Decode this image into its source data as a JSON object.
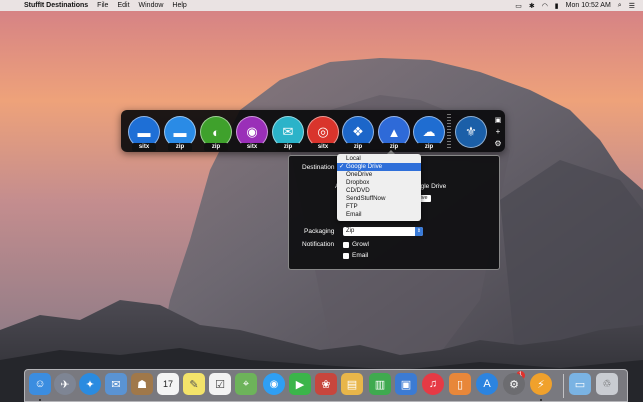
{
  "menubar": {
    "apple_icon": "",
    "app_name": "StuffIt Destinations",
    "menus": [
      "File",
      "Edit",
      "Window",
      "Help"
    ],
    "clock": "Mon 10:52 AM",
    "status_icons": [
      "bluetooth-icon",
      "wifi-icon",
      "battery-icon"
    ],
    "spotlight_icon": "⌕",
    "list_icon": "☰"
  },
  "destinations": [
    {
      "icon": "folder-icon",
      "glyph": "▬",
      "badge": "sitx",
      "color": "#1e6fd6"
    },
    {
      "icon": "folder-icon",
      "glyph": "▬",
      "badge": "zip",
      "color": "#2a8be6"
    },
    {
      "icon": "half-circle-icon",
      "glyph": "◐",
      "badge": "zip",
      "color": "#3fa12c"
    },
    {
      "icon": "disc-icon",
      "glyph": "◉",
      "badge": "sitx",
      "color": "#9a2fb8"
    },
    {
      "icon": "mail-icon",
      "glyph": "✉",
      "badge": "zip",
      "color": "#2bb3c9"
    },
    {
      "icon": "cd-icon",
      "glyph": "◎",
      "badge": "sitx",
      "color": "#d9342c"
    },
    {
      "icon": "dropbox-icon",
      "glyph": "❖",
      "badge": "zip",
      "color": "#1c66c9"
    },
    {
      "icon": "google-drive-icon",
      "glyph": "▲",
      "badge": "zip",
      "color": "#2e6ad8"
    },
    {
      "icon": "cloud-icon",
      "glyph": "☁",
      "badge": "zip",
      "color": "#1f6dd1"
    },
    {
      "icon": "sendstuffnow-icon",
      "glyph": "⚜",
      "badge": "",
      "color": "#1b5fa8"
    }
  ],
  "bar_controls": [
    "lock-icon",
    "plus-icon",
    "gear-icon"
  ],
  "bar_control_glyphs": [
    "🔒",
    "+",
    "⚙"
  ],
  "panel": {
    "destination_label": "Destination",
    "behind_text": "ogle Drive",
    "behind_field": "ive",
    "behind_letter": "A",
    "packaging_label": "Packaging",
    "packaging_value": "Zip",
    "notification_label": "Notification",
    "growl_label": "Growl",
    "email_label": "Email"
  },
  "dropdown": {
    "options": [
      "Local",
      "Google Drive",
      "OneDrive",
      "Dropbox",
      "CD/DVD",
      "SendStuffNow",
      "FTP",
      "Email"
    ],
    "selected": "Google Drive",
    "check": "✓"
  },
  "dock": {
    "apps": [
      {
        "name": "finder-icon",
        "glyph": "☺",
        "color": "#3b8de0"
      },
      {
        "name": "launchpad-icon",
        "glyph": "✈",
        "color": "#7e8594"
      },
      {
        "name": "safari-icon",
        "glyph": "✦",
        "color": "#2a8be0"
      },
      {
        "name": "mail-app-icon",
        "glyph": "✉",
        "color": "#5a93d3"
      },
      {
        "name": "contacts-icon",
        "glyph": "☗",
        "color": "#a0784a"
      },
      {
        "name": "calendar-icon",
        "glyph": "17",
        "color": "#f4f4f4"
      },
      {
        "name": "notes-icon",
        "glyph": "✎",
        "color": "#f3e36a"
      },
      {
        "name": "reminders-icon",
        "glyph": "☑",
        "color": "#f2f2f2"
      },
      {
        "name": "maps-icon",
        "glyph": "⌖",
        "color": "#6db35a"
      },
      {
        "name": "messages-icon",
        "glyph": "💬",
        "color": "#2f9ff3"
      },
      {
        "name": "facetime-icon",
        "glyph": "▶",
        "color": "#3bb54a"
      },
      {
        "name": "photo-booth-icon",
        "glyph": "❀",
        "color": "#c7463d"
      },
      {
        "name": "keynote-icon",
        "glyph": "▤",
        "color": "#e8b64a"
      },
      {
        "name": "numbers-icon",
        "glyph": "▥",
        "color": "#3faa4f"
      },
      {
        "name": "presentation-icon",
        "glyph": "▣",
        "color": "#3c7bd3"
      },
      {
        "name": "music-icon",
        "glyph": "♫",
        "color": "#e63a45"
      },
      {
        "name": "ibooks-icon",
        "glyph": "▯",
        "color": "#e8873a"
      },
      {
        "name": "app-store-icon",
        "glyph": "A",
        "color": "#2c84e0"
      },
      {
        "name": "system-preferences-icon",
        "glyph": "⚙",
        "color": "#6c6c70"
      },
      {
        "name": "stuffit-icon",
        "glyph": "⚡",
        "color": "#f0a12c"
      }
    ],
    "app_store_badge": "1",
    "folder_glyph": "▭",
    "trash_glyph": "🗑"
  }
}
